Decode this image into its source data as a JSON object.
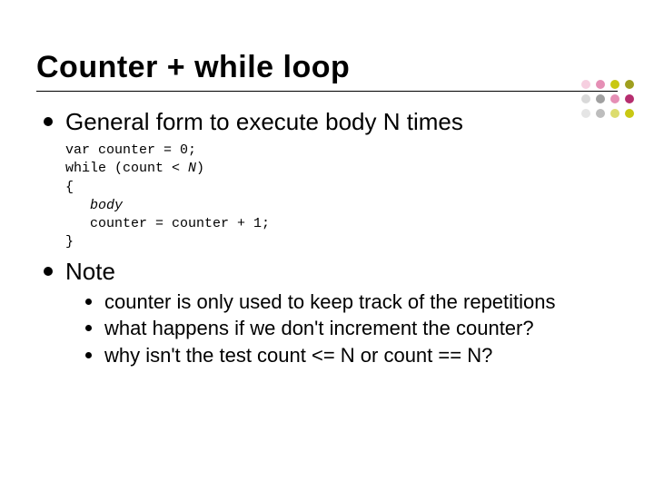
{
  "title": "Counter + while loop",
  "dots": {
    "row1": [
      "#f6cfe0",
      "#e58fb5",
      "#c9c813",
      "#9f9f1f"
    ],
    "row2": [
      "#d9d9d9",
      "#a0a0a0",
      "#e58fb5",
      "#b62e6f"
    ],
    "row3": [
      "#e5e5e5",
      "#bdbdbd",
      "#dcdc6e",
      "#c9c813"
    ]
  },
  "items": [
    {
      "heading": "General form to execute body N times",
      "code_lines": [
        "var counter = 0;",
        "while (count < ",
        ")",
        "{",
        "   ",
        "   counter = counter + 1;",
        "}"
      ],
      "code_N": "N",
      "code_body": "body"
    },
    {
      "heading": "Note",
      "sub": [
        "counter is only used to keep track of the repetitions",
        "what happens if we don't increment the counter?",
        "why isn't the test count <= N or count == N?"
      ]
    }
  ]
}
